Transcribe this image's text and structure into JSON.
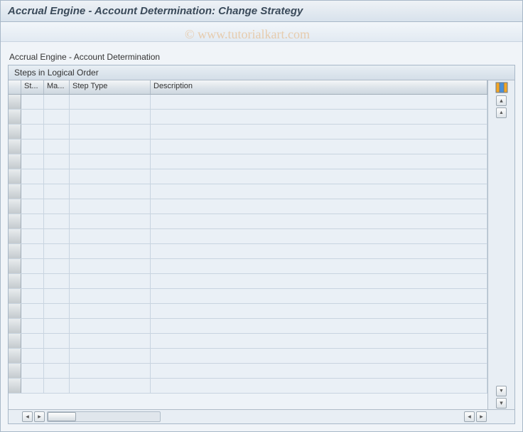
{
  "title": "Accrual Engine - Account Determination: Change Strategy",
  "watermark": "© www.tutorialkart.com",
  "section_label": "Accrual Engine - Account Determination",
  "panel_title": "Steps in Logical Order",
  "columns": {
    "st": "St...",
    "ma": "Ma...",
    "step_type": "Step Type",
    "description": "Description"
  },
  "rows": [
    {
      "st": "",
      "ma": "",
      "type": "",
      "desc": ""
    },
    {
      "st": "",
      "ma": "",
      "type": "",
      "desc": ""
    },
    {
      "st": "",
      "ma": "",
      "type": "",
      "desc": ""
    },
    {
      "st": "",
      "ma": "",
      "type": "",
      "desc": ""
    },
    {
      "st": "",
      "ma": "",
      "type": "",
      "desc": ""
    },
    {
      "st": "",
      "ma": "",
      "type": "",
      "desc": ""
    },
    {
      "st": "",
      "ma": "",
      "type": "",
      "desc": ""
    },
    {
      "st": "",
      "ma": "",
      "type": "",
      "desc": ""
    },
    {
      "st": "",
      "ma": "",
      "type": "",
      "desc": ""
    },
    {
      "st": "",
      "ma": "",
      "type": "",
      "desc": ""
    },
    {
      "st": "",
      "ma": "",
      "type": "",
      "desc": ""
    },
    {
      "st": "",
      "ma": "",
      "type": "",
      "desc": ""
    },
    {
      "st": "",
      "ma": "",
      "type": "",
      "desc": ""
    },
    {
      "st": "",
      "ma": "",
      "type": "",
      "desc": ""
    },
    {
      "st": "",
      "ma": "",
      "type": "",
      "desc": ""
    },
    {
      "st": "",
      "ma": "",
      "type": "",
      "desc": ""
    },
    {
      "st": "",
      "ma": "",
      "type": "",
      "desc": ""
    },
    {
      "st": "",
      "ma": "",
      "type": "",
      "desc": ""
    },
    {
      "st": "",
      "ma": "",
      "type": "",
      "desc": ""
    },
    {
      "st": "",
      "ma": "",
      "type": "",
      "desc": ""
    }
  ]
}
